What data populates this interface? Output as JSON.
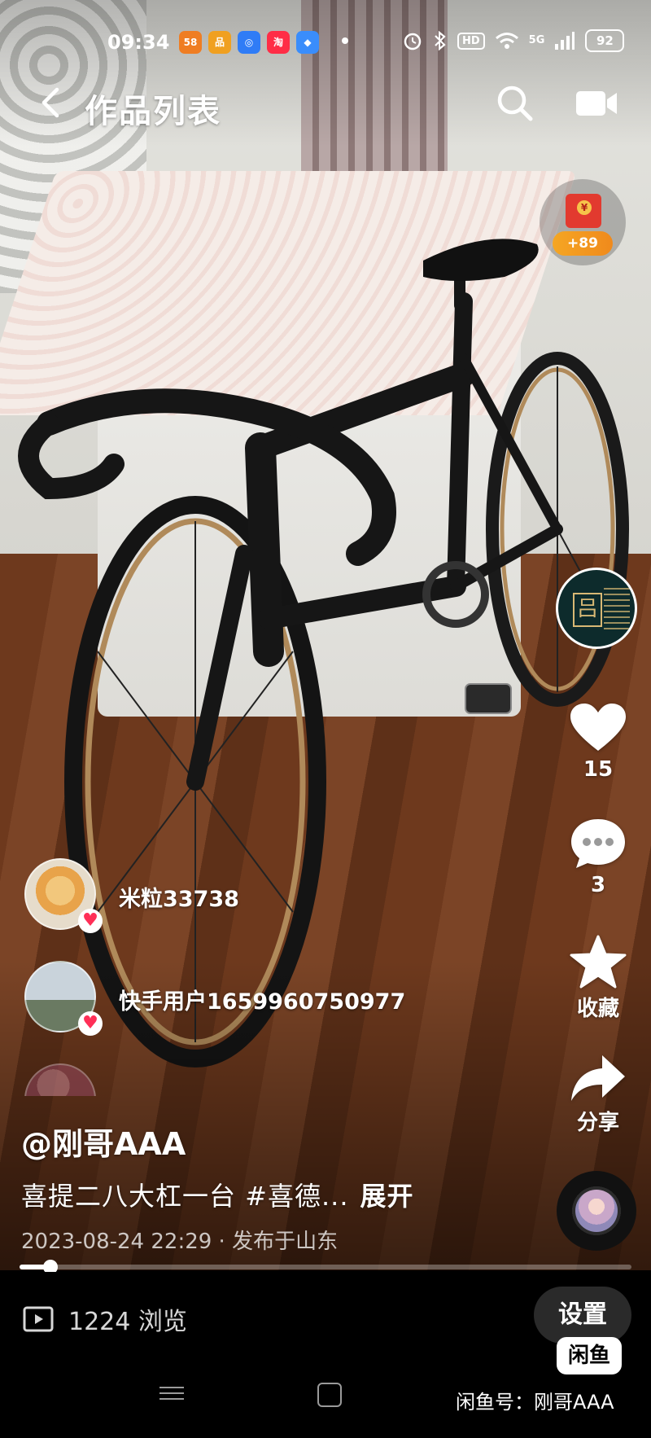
{
  "status_bar": {
    "time": "09:34",
    "app_icons": [
      {
        "label": "58",
        "color": "#ef7d22"
      },
      {
        "label": "品",
        "color": "#f0a020"
      },
      {
        "label": "◎",
        "color": "#2f7cf6"
      },
      {
        "label": "淘",
        "color": "#ff2d46"
      },
      {
        "label": "◆",
        "color": "#3a8dfb"
      }
    ],
    "hd": "HD",
    "network": "5G",
    "battery": "92"
  },
  "header": {
    "title": "作品列表"
  },
  "reward": {
    "badge": "+89"
  },
  "actions": {
    "likes": "15",
    "comments": "3",
    "favorite_label": "收藏",
    "share_label": "分享"
  },
  "viewers": [
    {
      "name": "米粒33738"
    },
    {
      "name": "快手用户1659960750977"
    }
  ],
  "post": {
    "username": "@刚哥AAA",
    "description": "喜提二八大杠一台 #喜德...",
    "expand": "展开",
    "meta": "2023-08-24 22:29 · 发布于山东",
    "progress": 0.05
  },
  "bottom": {
    "views": "1224 浏览",
    "settings": "设置",
    "xianyu_logo": "闲鱼",
    "xianyu_id": "闲鱼号：刚哥AAA"
  },
  "colors": {
    "like": "#ffffff",
    "heart_badge": "#ff2f57",
    "reward_pill": "#f5a623",
    "red_packet": "#e23a2f"
  }
}
